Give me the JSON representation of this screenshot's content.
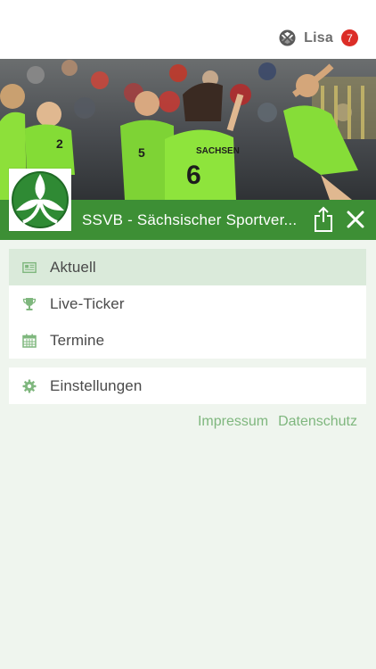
{
  "header": {
    "user_name": "Lisa",
    "notification_count": "7",
    "brand_icon": "soccer-ball-icon"
  },
  "club": {
    "name": "SSVB - Sächsischer Sportver...",
    "logo_icon": "volleyball-logo",
    "share_icon": "share-icon",
    "close_icon": "close-icon",
    "hero_image": "volleyball-team-celebration-photo"
  },
  "menu": {
    "main_items": [
      {
        "label": "Aktuell",
        "icon": "newspaper-icon",
        "active": true
      },
      {
        "label": "Live-Ticker",
        "icon": "trophy-icon",
        "active": false
      },
      {
        "label": "Termine",
        "icon": "calendar-icon",
        "active": false
      }
    ],
    "secondary_items": [
      {
        "label": "Einstellungen",
        "icon": "gear-icon",
        "active": false
      }
    ]
  },
  "footer_links": {
    "impressum": "Impressum",
    "datenschutz": "Datenschutz"
  },
  "colors": {
    "brand_green": "#3d8f35",
    "active_row": "#daeada",
    "link_green": "#7fb77e",
    "badge_red": "#dc2d27",
    "background": "#eff5ee"
  }
}
